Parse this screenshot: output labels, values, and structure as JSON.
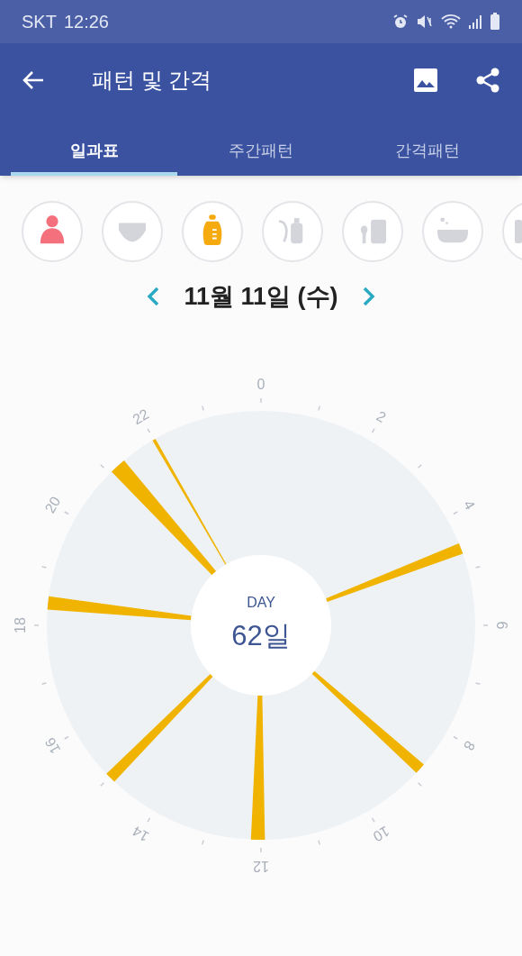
{
  "status_bar": {
    "carrier": "SKT",
    "time": "12:26"
  },
  "app_bar": {
    "title": "패턴 및 간격"
  },
  "tabs": [
    {
      "label": "일과표",
      "selected": true
    },
    {
      "label": "주간패턴",
      "selected": false
    },
    {
      "label": "간격패턴",
      "selected": false
    }
  ],
  "categories": [
    {
      "kind": "breastfeed",
      "color": "#f4707c"
    },
    {
      "kind": "diaper",
      "color": "#d3d5db"
    },
    {
      "kind": "bottle",
      "color": "#f5aa10"
    },
    {
      "kind": "pump",
      "color": "#d3d5db"
    },
    {
      "kind": "food",
      "color": "#d3d5db"
    },
    {
      "kind": "bath",
      "color": "#d3d5db"
    },
    {
      "kind": "other",
      "color": "#d3d5db"
    }
  ],
  "date_nav": {
    "date": "11월 11일 (수)"
  },
  "clock": {
    "center_label": "DAY",
    "center_value": "62일",
    "hour_labels": [
      "0",
      "2",
      "4",
      "6",
      "8",
      "10",
      "12",
      "14",
      "16",
      "18",
      "20",
      "22"
    ]
  }
}
